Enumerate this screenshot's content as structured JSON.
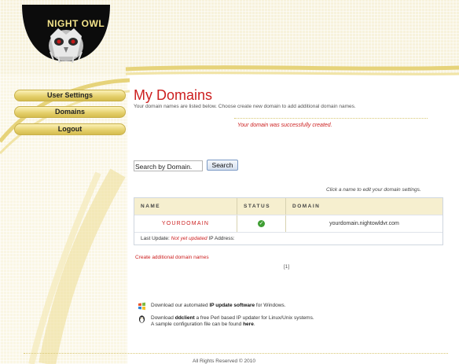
{
  "header": {
    "logo_text": "NIGHT OWL"
  },
  "sidebar": {
    "items": [
      {
        "label": "User Settings"
      },
      {
        "label": "Domains"
      },
      {
        "label": "Logout"
      }
    ]
  },
  "main": {
    "title": "My Domains",
    "subtitle": "Your domain names are listed below. Choose create new domain to add additional domain names.",
    "success_message": "Your domain was successfully created.",
    "search": {
      "placeholder": "Search by Domain.",
      "button_label": "Search"
    },
    "hint": "Click a name to edit your domain settings.",
    "table": {
      "headers": [
        "NAME",
        "STATUS",
        "DOMAIN"
      ],
      "rows": [
        {
          "name": "YOURDOMAIN",
          "status": "ok",
          "domain": "yourdomain.nightowldvr.com"
        }
      ],
      "footer": {
        "label": "Last Update:",
        "value": "Not yet updated",
        "ip_label": "IP Address:"
      }
    },
    "create_link": "Create additional domain names",
    "pager": "[1]",
    "downloads": [
      {
        "icon": "windows-icon",
        "prefix": "Download our automated ",
        "bold": "IP update software",
        "suffix": " for Windows."
      },
      {
        "icon": "linux-icon",
        "prefix": "Download ",
        "bold": "ddclient",
        "suffix": " a free Perl based IP updater for Linux/Unix systems.",
        "line2_prefix": "A sample configuration file can be found ",
        "line2_bold": "here",
        "line2_suffix": "."
      }
    ]
  },
  "footer": {
    "text": "All Rights Reserved © 2010"
  },
  "colors": {
    "accent": "#cc1f1f",
    "gold": "#e4cf6a",
    "status_ok": "#3f9e33"
  }
}
